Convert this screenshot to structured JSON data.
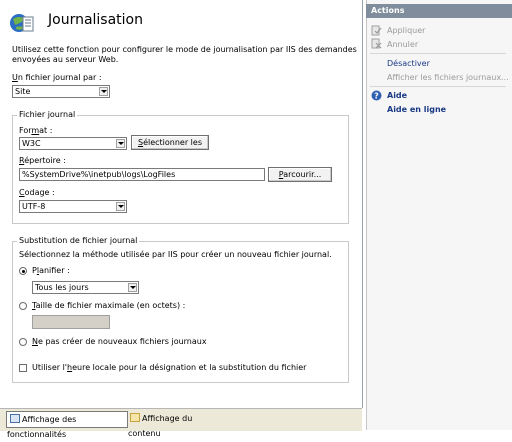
{
  "page": {
    "title": "Journalisation",
    "description": "Utilisez cette fonction pour configurer le mode de journalisation par IIS des demandes envoyées au serveur Web."
  },
  "log_per": {
    "label": "Un fichier journal par :",
    "value": "Site"
  },
  "log_file": {
    "legend": "Fichier journal",
    "format_label": "Format :",
    "format_value": "W3C",
    "select_fields_button": "Sélectionner les",
    "directory_label": "Répertoire :",
    "directory_value": "%SystemDrive%\\inetpub\\logs\\LogFiles",
    "browse_button": "Parcourir...",
    "encoding_label": "Codage :",
    "encoding_value": "UTF-8"
  },
  "rollover": {
    "legend": "Substitution de fichier journal",
    "description": "Sélectionnez la méthode utilisée par IIS pour créer un nouveau fichier journal.",
    "schedule_label": "Planifier :",
    "schedule_value": "Tous les jours",
    "max_size_label": "Taille de fichier maximale (en octets) :",
    "max_size_value": "",
    "no_new_label": "Ne pas créer de nouveaux fichiers journaux",
    "local_time_label": "Utiliser l'heure locale pour la désignation et la substitution du fichier",
    "selected_option": "schedule",
    "local_time_checked": false
  },
  "bottom_tabs": {
    "features_view": "Affichage des fonctionnalités",
    "content_view": "Affichage du contenu"
  },
  "actions": {
    "header": "Actions",
    "apply": "Appliquer",
    "cancel": "Annuler",
    "disable": "Désactiver",
    "view_log_files": "Afficher les fichiers journaux...",
    "help": "Aide",
    "online_help": "Aide en ligne"
  },
  "colors": {
    "actions_header_bg": "#7f8d9c",
    "link": "#1a3a86",
    "disabled": "#9a9a9a"
  }
}
